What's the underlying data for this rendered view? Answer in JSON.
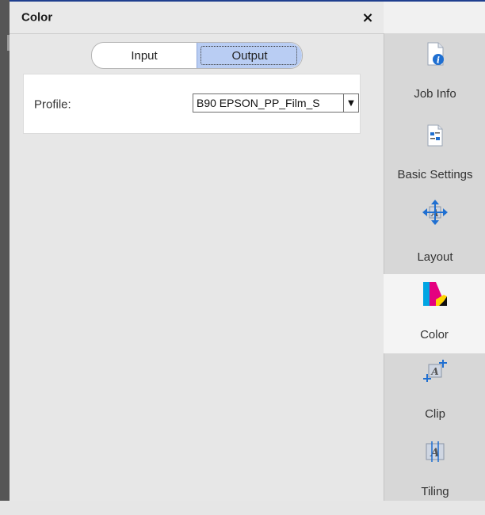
{
  "panel": {
    "title": "Color",
    "close_label": "×"
  },
  "mode_toggle": {
    "input_label": "Input",
    "output_label": "Output",
    "selected": "Output"
  },
  "profile": {
    "label": "Profile:",
    "value": "B90 EPSON_PP_Film_S"
  },
  "sidebar": {
    "tabs": [
      {
        "label": "Job Info",
        "icon": "job-info-icon"
      },
      {
        "label": "Basic Settings",
        "icon": "basic-settings-icon"
      },
      {
        "label": "Layout",
        "icon": "layout-icon"
      },
      {
        "label": "Color",
        "icon": "color-icon",
        "active": true
      },
      {
        "label": "Clip",
        "icon": "clip-icon"
      },
      {
        "label": "Tiling",
        "icon": "tiling-icon"
      }
    ]
  },
  "colors": {
    "accent_blue": "#1f6fd1",
    "toggle_active": "#b9cdf3",
    "sidebar_group": "#d7d7d7",
    "sidebar_active": "#f4f4f4"
  }
}
